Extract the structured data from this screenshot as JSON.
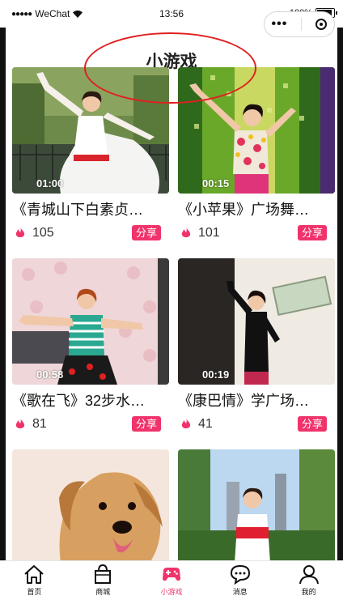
{
  "status_bar": {
    "carrier": "WeChat",
    "signal_dots": "●●●●●",
    "time": "13:56",
    "battery_percent": "100%",
    "battery_level": 1.0
  },
  "capsule": {
    "more_icon": "more-dots-icon",
    "close_icon": "target-icon"
  },
  "header": {
    "title": "小游戏"
  },
  "colors": {
    "accent": "#f0336a",
    "highlight": "#e02020"
  },
  "videos": [
    {
      "title": "《青城山下白素贞…",
      "duration": "01:00",
      "likes": "105",
      "share_label": "分享",
      "icon": "flame-icon"
    },
    {
      "title": "《小苹果》广场舞…",
      "duration": "00:15",
      "likes": "101",
      "share_label": "分享",
      "icon": "flame-icon"
    },
    {
      "title": "《歌在飞》32步水…",
      "duration": "00:58",
      "likes": "81",
      "share_label": "分享",
      "icon": "flame-icon"
    },
    {
      "title": "《康巴情》学广场…",
      "duration": "00:19",
      "likes": "41",
      "share_label": "分享",
      "icon": "flame-icon"
    },
    {
      "title": "",
      "duration": "",
      "likes": "",
      "share_label": "",
      "icon": ""
    },
    {
      "title": "",
      "duration": "",
      "likes": "",
      "share_label": "",
      "icon": ""
    }
  ],
  "tab_bar": {
    "items": [
      {
        "label": "首页",
        "icon": "home-icon",
        "active": false
      },
      {
        "label": "商城",
        "icon": "shopping-bag-icon",
        "active": false
      },
      {
        "label": "小游戏",
        "icon": "gamepad-icon",
        "active": true
      },
      {
        "label": "消息",
        "icon": "chat-bubble-icon",
        "active": false
      },
      {
        "label": "我的",
        "icon": "user-icon",
        "active": false
      }
    ]
  }
}
